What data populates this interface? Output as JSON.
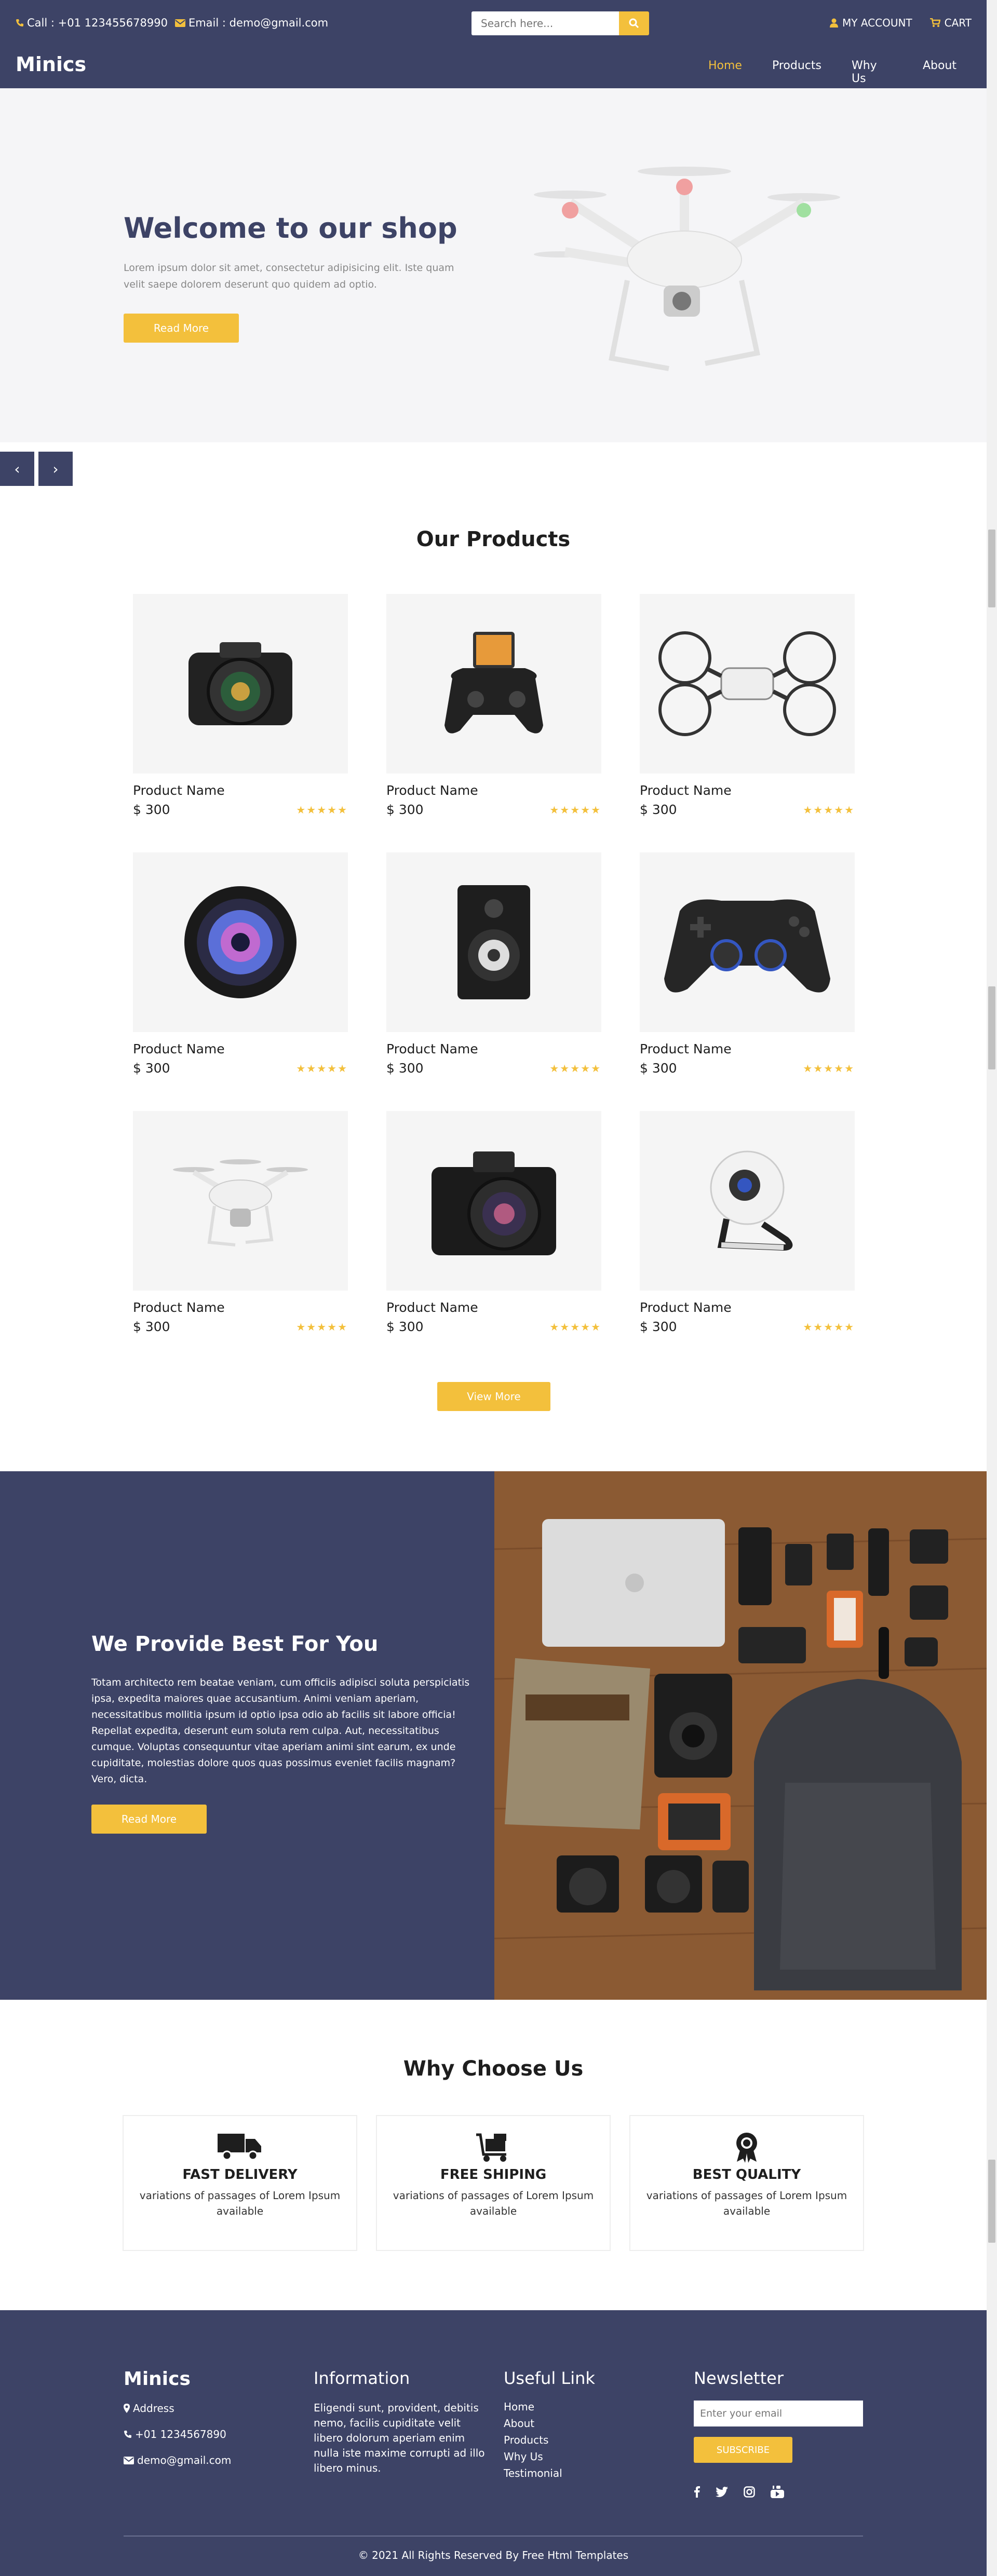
{
  "topbar": {
    "call": "Call : +01 123455678990",
    "email": "Email : demo@gmail.com",
    "search_placeholder": "Search here...",
    "account": "MY ACCOUNT",
    "cart": "CART"
  },
  "navbar": {
    "logo": "Minics",
    "links": [
      "Home",
      "Products",
      "Why Us",
      "About"
    ],
    "active": "Home"
  },
  "hero": {
    "title": "Welcome to our shop",
    "text": "Lorem ipsum dolor sit amet, consectetur adipisicing elit. Iste quam velit saepe dolorem deserunt quo quidem ad optio.",
    "button": "Read More",
    "prev": "‹",
    "next": "›"
  },
  "products": {
    "title": "Our Products",
    "items": [
      {
        "name": "Product Name",
        "price": "$ 300",
        "rating": 5,
        "image": "dslr-camera"
      },
      {
        "name": "Product Name",
        "price": "$ 300",
        "rating": 5,
        "image": "phone-gamepad"
      },
      {
        "name": "Product Name",
        "price": "$ 300",
        "rating": 5,
        "image": "mini-drone"
      },
      {
        "name": "Product Name",
        "price": "$ 300",
        "rating": 5,
        "image": "camera-lens"
      },
      {
        "name": "Product Name",
        "price": "$ 300",
        "rating": 5,
        "image": "speaker"
      },
      {
        "name": "Product Name",
        "price": "$ 300",
        "rating": 5,
        "image": "gamepad"
      },
      {
        "name": "Product Name",
        "price": "$ 300",
        "rating": 5,
        "image": "white-drone"
      },
      {
        "name": "Product Name",
        "price": "$ 300",
        "rating": 5,
        "image": "black-camera"
      },
      {
        "name": "Product Name",
        "price": "$ 300",
        "rating": 5,
        "image": "webcam"
      }
    ],
    "stars": "★★★★★",
    "view_more": "View More"
  },
  "best": {
    "title": "We Provide Best For You",
    "text": "Totam architecto rem beatae veniam, cum officiis adipisci soluta perspiciatis ipsa, expedita maiores quae accusantium. Animi veniam aperiam, necessitatibus mollitia ipsum id optio ipsa odio ab facilis sit labore officia! Repellat expedita, deserunt eum soluta rem culpa. Aut, necessitatibus cumque. Voluptas consequuntur vitae aperiam animi sint earum, ex unde cupiditate, molestias dolore quos quas possimus eveniet facilis magnam? Vero, dicta.",
    "button": "Read More"
  },
  "why": {
    "title": "Why Choose Us",
    "cards": [
      {
        "title": "FAST DELIVERY",
        "text": "variations of passages of Lorem Ipsum available",
        "icon": "truck-icon"
      },
      {
        "title": "FREE SHIPING",
        "text": "variations of passages of Lorem Ipsum available",
        "icon": "cart-icon"
      },
      {
        "title": "BEST QUALITY",
        "text": "variations of passages of Lorem Ipsum available",
        "icon": "award-icon"
      }
    ]
  },
  "footer": {
    "brand": "Minics",
    "address": "Address",
    "phone": "+01 1234567890",
    "email": "demo@gmail.com",
    "info_title": "Information",
    "info_text": "Eligendi sunt, provident, debitis nemo, facilis cupiditate velit libero dolorum aperiam enim nulla iste maxime corrupti ad illo libero minus.",
    "useful_title": "Useful Link",
    "useful_links": [
      "Home",
      "About",
      "Products",
      "Why Us",
      "Testimonial"
    ],
    "newsletter_title": "Newsletter",
    "newsletter_placeholder": "Enter your email",
    "subscribe": "SUBSCRIBE",
    "copyright": "© 2021 All Rights Reserved By Free Html Templates"
  },
  "colors": {
    "primary": "#3d4366",
    "accent": "#f3c03c",
    "hero_bg": "#f5f5f7"
  }
}
